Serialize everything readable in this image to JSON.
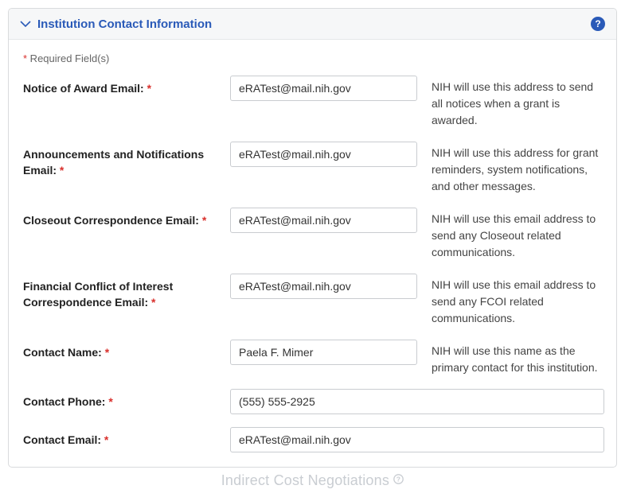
{
  "header": {
    "title": "Institution Contact Information",
    "help_label": "?"
  },
  "required_note": {
    "asterisk": "*",
    "text": " Required Field(s)"
  },
  "fields": {
    "noa_email": {
      "label": "Notice of Award Email:",
      "value": "eRATest@mail.nih.gov",
      "help": "NIH will use this address to send all notices when a grant is awarded."
    },
    "announcements_email": {
      "label": "Announcements and Notifications Email:",
      "value": "eRATest@mail.nih.gov",
      "help": "NIH will use this address for grant reminders, system notifications, and other messages."
    },
    "closeout_email": {
      "label": "Closeout Correspondence Email:",
      "value": "eRATest@mail.nih.gov",
      "help": "NIH will use this email address to send any Closeout related communications."
    },
    "fcoi_email": {
      "label": "Financial Conflict of Interest Correspondence Email:",
      "value": "eRATest@mail.nih.gov",
      "help": "NIH will use this email address to send any FCOI related communications."
    },
    "contact_name": {
      "label": "Contact Name:",
      "value": "Paela F. Mimer",
      "help": "NIH will use this name as the primary contact for this institution."
    },
    "contact_phone": {
      "label": "Contact Phone:",
      "value": "(555) 555-2925"
    },
    "contact_email": {
      "label": "Contact Email:",
      "value": "eRATest@mail.nih.gov"
    }
  },
  "ghost": {
    "text": "Indirect Cost Negotiations "
  },
  "asterisk": "*"
}
